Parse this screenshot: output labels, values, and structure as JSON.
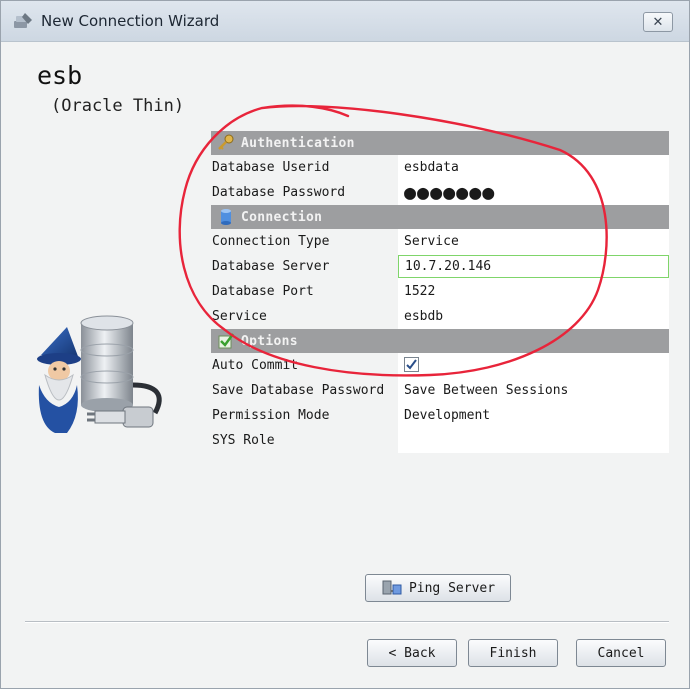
{
  "window": {
    "title": "New Connection Wizard",
    "close_icon": "close-icon",
    "close_glyph": "✕"
  },
  "connection": {
    "name": "esb",
    "driver": "(Oracle Thin)"
  },
  "sections": {
    "authentication": {
      "label": "Authentication",
      "icon": "key-icon"
    },
    "connection": {
      "label": "Connection",
      "icon": "database-icon"
    },
    "options": {
      "label": "Options",
      "icon": "check-icon"
    }
  },
  "fields": {
    "userid": {
      "label": "Database Userid",
      "value": "esbdata"
    },
    "password": {
      "label": "Database Password",
      "value": "●●●●●●●"
    },
    "conn_type": {
      "label": "Connection Type",
      "value": "Service"
    },
    "server": {
      "label": "Database Server",
      "value": "10.7.20.146"
    },
    "port": {
      "label": "Database Port",
      "value": "1522"
    },
    "service": {
      "label": "Service",
      "value": "esbdb"
    },
    "auto_commit": {
      "label": "Auto Commit",
      "checked": true,
      "glyph": "✓"
    },
    "save_password": {
      "label": "Save Database Password",
      "value": "Save Between Sessions"
    },
    "permission": {
      "label": "Permission Mode",
      "value": "Development"
    },
    "sys_role": {
      "label": "SYS Role",
      "value": ""
    }
  },
  "buttons": {
    "ping": "Ping Server",
    "back": "< Back",
    "finish": "Finish",
    "cancel": "Cancel"
  },
  "colors": {
    "section_bg": "#9d9ea0",
    "input_border": "#7fd56a",
    "annotation": "#e8243a"
  }
}
